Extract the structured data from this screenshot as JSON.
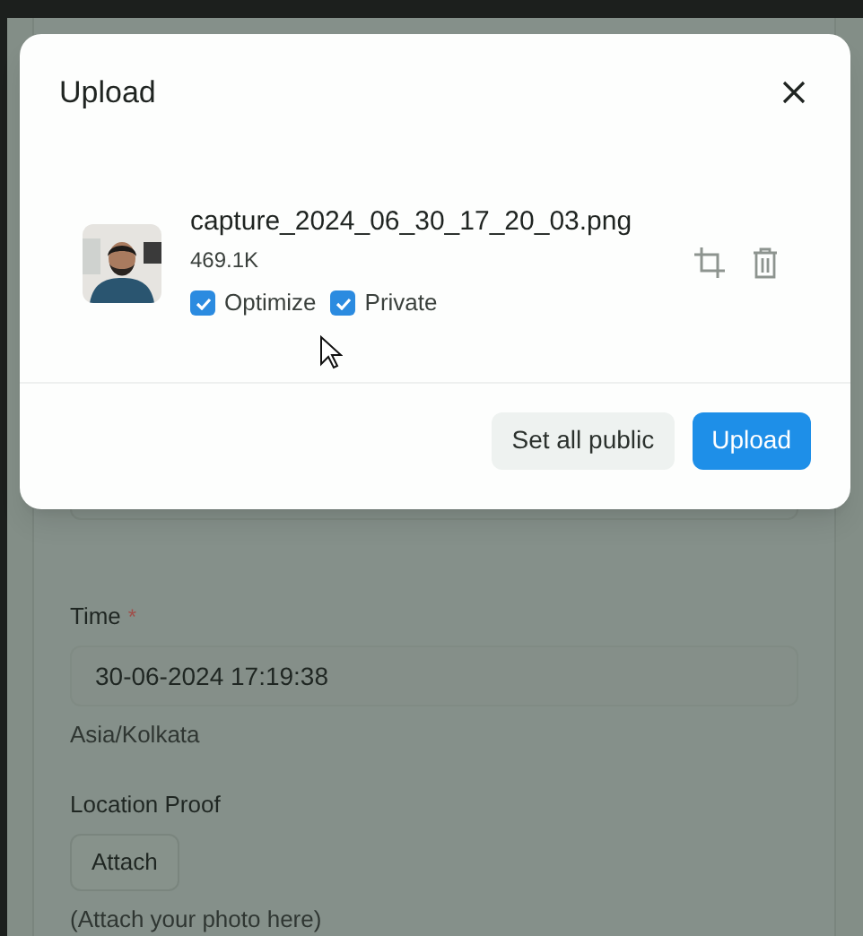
{
  "dialog": {
    "title": "Upload",
    "files": [
      {
        "name": "capture_2024_06_30_17_20_03.png",
        "size": "469.1K",
        "options": [
          {
            "label": "Optimize",
            "checked": true
          },
          {
            "label": "Private",
            "checked": true
          }
        ]
      }
    ],
    "buttons": [
      {
        "label": "Set all public",
        "kind": "secondary"
      },
      {
        "label": "Upload",
        "kind": "primary"
      }
    ]
  },
  "form": {
    "fields": [
      {
        "kind": "input",
        "label": "Time",
        "required_mark": "*",
        "value": "30-06-2024 17:19:38",
        "hint": "Asia/Kolkata"
      },
      {
        "kind": "attach",
        "label": "Location Proof",
        "button": "Attach",
        "hint": "(Attach your photo here)"
      }
    ]
  }
}
